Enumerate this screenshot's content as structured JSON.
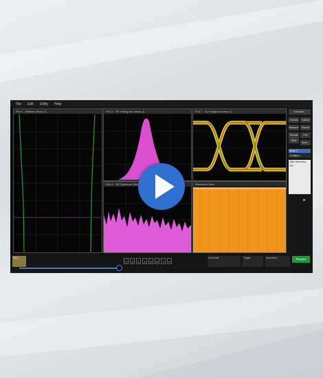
{
  "menu": [
    "File",
    "Edit",
    "Utility",
    "Help"
  ],
  "plots": {
    "bathtub": "Plot 4 - Bathtub (Meas 2)",
    "histogram": "Plot 2 - TIE Histogram (Meas 2)",
    "spectrum": "Plot 3 - TIE Spectrum (Meas 2)",
    "eye": "Plot 1 - Eye Diagram (Meas 1)",
    "waveform": "Waveform View"
  },
  "side_panel": {
    "add_new": "Add New...",
    "buttons": [
      "Cursors",
      "Callout",
      "Measure",
      "Search",
      "Results Table",
      "Plot",
      "More..."
    ],
    "meas_header": "Meas 1",
    "config": "Configure",
    "jitter_summary": "Jitter Summary",
    "meas_labels": [
      "TIE",
      ""
    ]
  },
  "bottom": {
    "channel_label": "Ch 1",
    "channels": [
      "1",
      "2",
      "3",
      "4",
      "5",
      "6",
      "7",
      "8"
    ],
    "horizontal_label": "Horizontal",
    "trigger_label": "Trigger",
    "acquisition_label": "Acquisition",
    "run_button": "Stopped"
  },
  "colors": {
    "accent_play": "#2e6fcf",
    "eye": "#e8e23a",
    "spectrum": "#e05bd8",
    "waveform": "#f0961f",
    "bathtub": "#2f9a3a"
  },
  "icons": {
    "play": "play-icon"
  },
  "progress": {
    "fraction": 0.36
  }
}
